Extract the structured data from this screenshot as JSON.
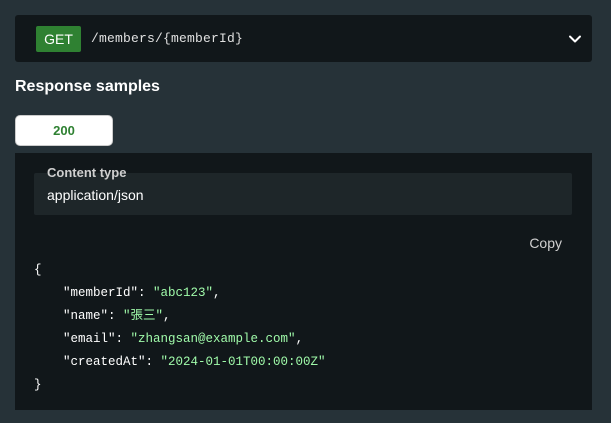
{
  "endpoint": {
    "method": "GET",
    "path": "/members/{memberId}"
  },
  "response_samples": {
    "title": "Response samples",
    "status_tab": "200",
    "content_type_label": "Content type",
    "content_type_value": "application/json",
    "copy_label": "Copy",
    "json": {
      "open_brace": "{",
      "close_brace": "}",
      "fields": [
        {
          "key": "\"memberId\"",
          "value": "\"abc123\"",
          "suffix": ","
        },
        {
          "key": "\"name\"",
          "value": "\"張三\"",
          "suffix": ","
        },
        {
          "key": "\"email\"",
          "value": "\"zhangsan@example.com\"",
          "suffix": ","
        },
        {
          "key": "\"createdAt\"",
          "value": "\"2024-01-01T00:00:00Z\"",
          "suffix": ""
        }
      ]
    }
  },
  "colors": {
    "background": "#263238",
    "panel": "#11171a",
    "method_get": "#2f8132",
    "json_string": "#a0fbaa"
  },
  "icons": {
    "expand": "chevron-down-icon"
  }
}
